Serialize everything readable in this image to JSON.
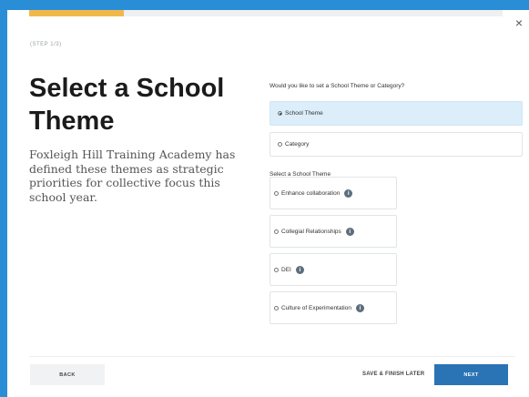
{
  "header": {
    "step_label": "(STEP 1/3)",
    "close_glyph": "×",
    "progress": 0.2
  },
  "left": {
    "title": "Select a School Theme",
    "description": "Foxleigh Hill Training Academy has defined these themes as strategic priorities for collective focus this school year."
  },
  "form": {
    "question": "Would you like to set a School Theme or Category?",
    "choices": [
      {
        "label": "School Theme",
        "selected": true
      },
      {
        "label": "Category",
        "selected": false
      }
    ],
    "themes_label": "Select a School Theme",
    "themes": [
      {
        "label": "Enhance collaboration"
      },
      {
        "label": "Collegial Relationships"
      },
      {
        "label": "DEI"
      },
      {
        "label": "Culture of Experimentation"
      }
    ],
    "info_glyph": "i"
  },
  "footer": {
    "back_label": "BACK",
    "save_label": "SAVE & FINISH LATER",
    "next_label": "NEXT"
  },
  "colors": {
    "accent": "#2a73b5",
    "progress": "#f0b84a",
    "selected_bg": "#dbeefa",
    "frame": "#2a8ed6"
  }
}
